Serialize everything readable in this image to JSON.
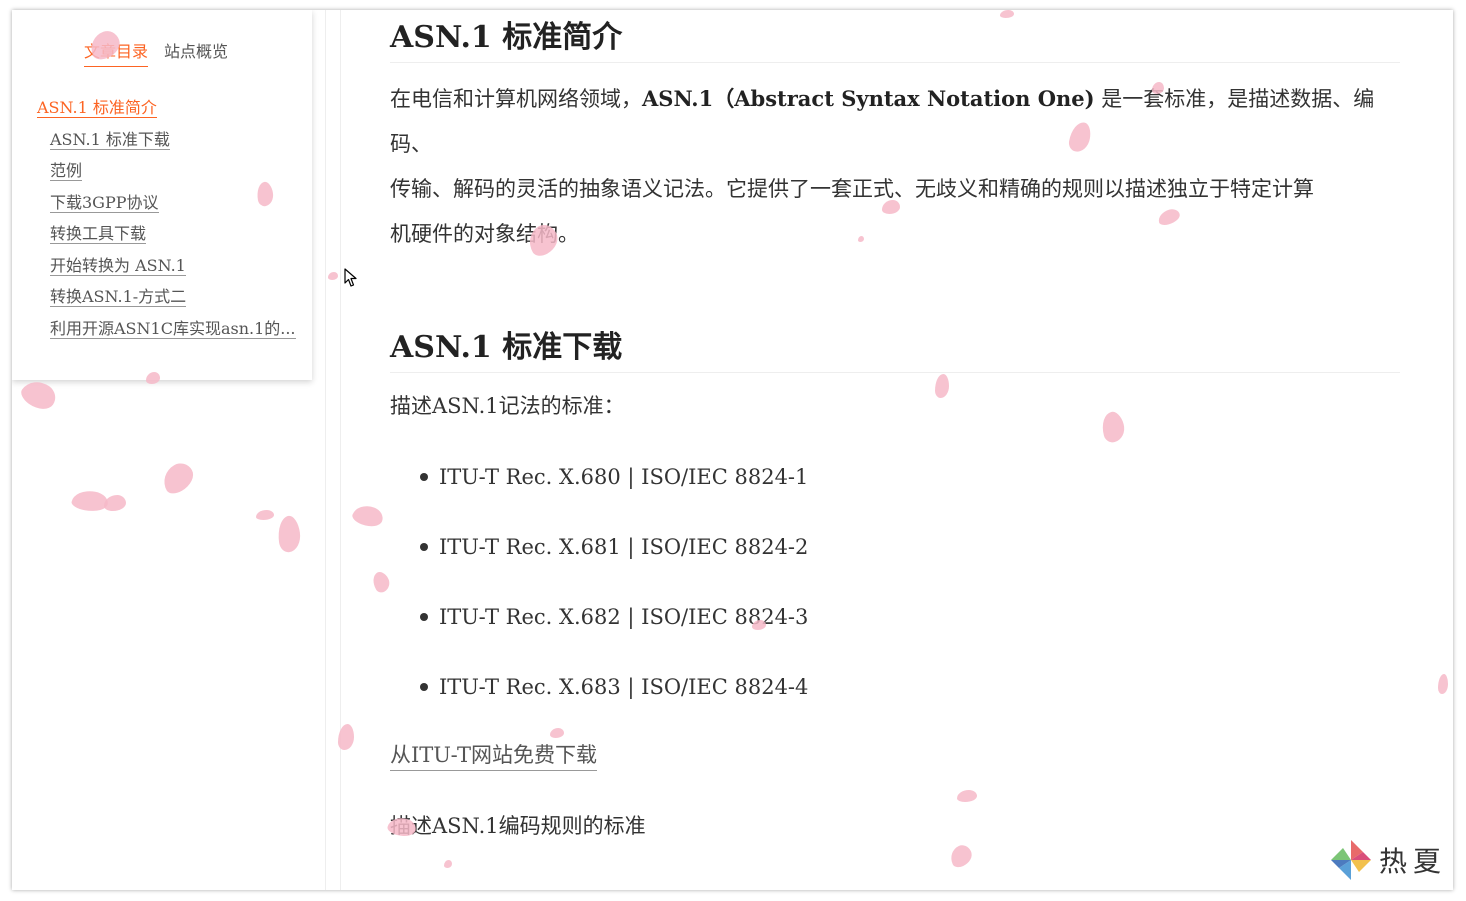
{
  "sidebar": {
    "tabs": [
      {
        "label": "文章目录",
        "active": true
      },
      {
        "label": "站点概览",
        "active": false
      }
    ],
    "toc": [
      {
        "label": "ASN.1 标准简介",
        "level": 1
      },
      {
        "label": "ASN.1 标准下载",
        "level": 2
      },
      {
        "label": "范例",
        "level": 2
      },
      {
        "label": "下载3GPP协议",
        "level": 2
      },
      {
        "label": "转换工具下载",
        "level": 2
      },
      {
        "label": "开始转换为 ASN.1",
        "level": 2
      },
      {
        "label": "转换ASN.1-方式二",
        "level": 2
      },
      {
        "label": "利用开源ASN1C库实现asn.1的...",
        "level": 2
      }
    ]
  },
  "article": {
    "section1": {
      "heading": "ASN.1 标准简介",
      "intro_prefix": "在电信和计算机网络领域，",
      "intro_bold": "ASN.1（Abstract Syntax Notation One)",
      "intro_line1_rest": " 是一套标准，是描述数据、编码、",
      "intro_line2": "传输、解码的灵活的抽象语义记法。它提供了一套正式、无歧义和精确的规则以描述独立于特定计算",
      "intro_line3": "机硬件的对象结构。"
    },
    "section2": {
      "heading": "ASN.1 标准下载",
      "notation_label": "描述ASN.1记法的标准：",
      "standards": [
        "ITU-T Rec. X.680 | ISO/IEC 8824-1",
        "ITU-T Rec. X.681 | ISO/IEC 8824-2",
        "ITU-T Rec. X.682 | ISO/IEC 8824-3",
        "ITU-T Rec. X.683 | ISO/IEC 8824-4"
      ],
      "download_link": "从ITU-T网站免费下载",
      "encoding_label": "描述ASN.1编码规则的标准"
    }
  },
  "watermark": {
    "text": "热夏"
  },
  "colors": {
    "accent": "#fc6423",
    "text": "#333333",
    "petal": "#f6b8c8"
  }
}
